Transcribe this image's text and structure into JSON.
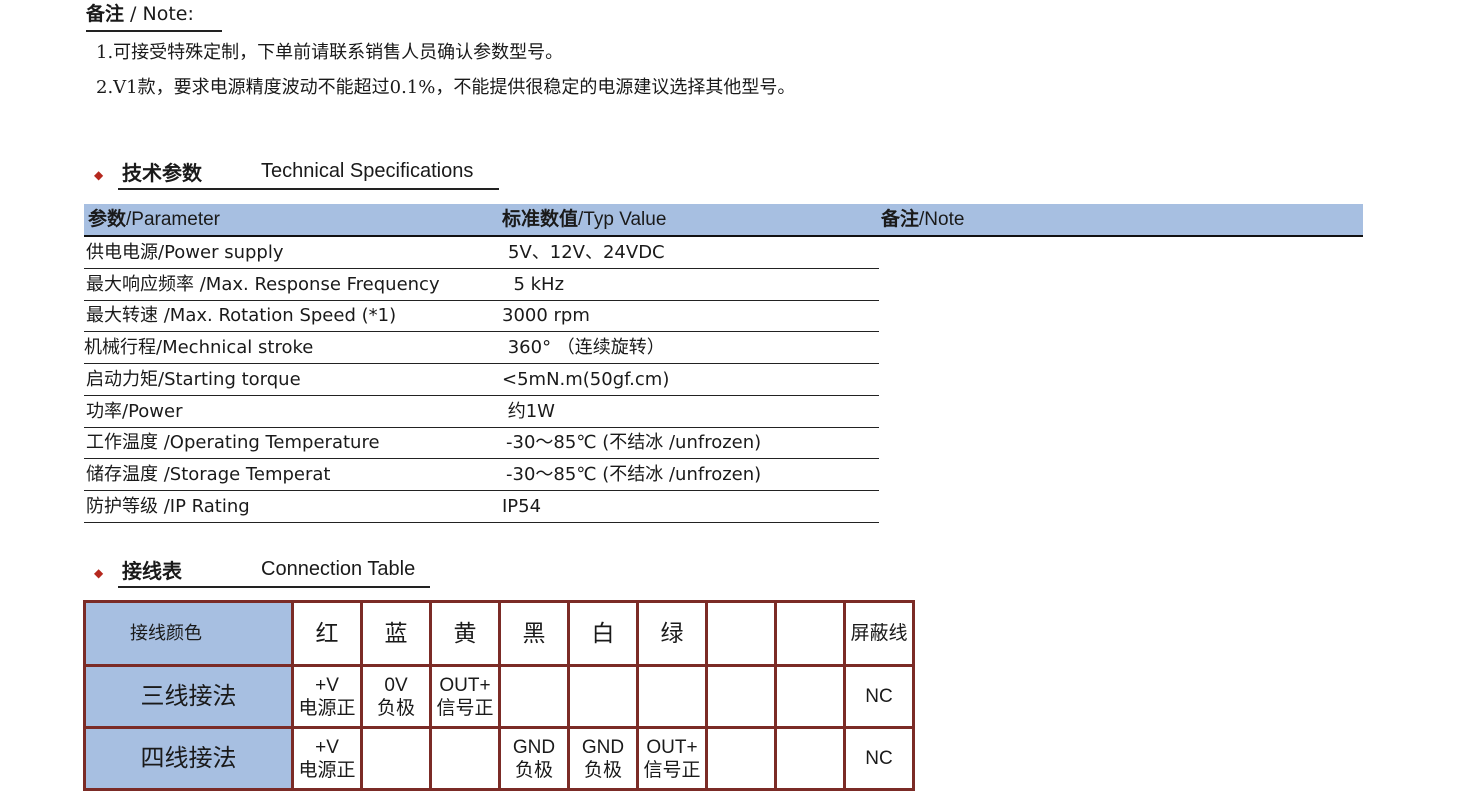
{
  "note": {
    "title_zh": "备注",
    "title_en": " / Note:",
    "items": [
      "1.可接受特殊定制，下单前请联系销售人员确认参数型号。",
      "2.V1款，要求电源精度波动不能超过0.1%，不能提供很稳定的电源建议选择其他型号。"
    ]
  },
  "tech_specs": {
    "heading_zh": "技术参数",
    "heading_en": "Technical Specifications",
    "columns": {
      "param_zh": "参数",
      "param_en": "/Parameter",
      "value_zh": "标准数值",
      "value_en": "/Typ Value",
      "note_zh": "备注",
      "note_en": "/Note"
    },
    "rows": [
      {
        "param": "供电电源/Power supply",
        "value": "5V、12V、24VDC"
      },
      {
        "param": "最大响应频率 /Max. Response Frequency",
        "value": "  5 kHz"
      },
      {
        "param": "最大转速 /Max. Rotation Speed (*1)",
        "value": "3000 rpm"
      },
      {
        "param": "机械行程/Mechnical stroke",
        "value": " 360° （连续旋转）"
      },
      {
        "param": "启动力矩/Starting torque",
        "value": "<5mN.m(50gf.cm)"
      },
      {
        "param": "功率/Power",
        "value": " 约1W"
      },
      {
        "param": "工作温度 /Operating Temperature",
        "value": "-30～85℃ (不结冰 /unfrozen)"
      },
      {
        "param": "储存温度 /Storage Temperat",
        "value": "-30～85℃ (不结冰 /unfrozen)"
      },
      {
        "param": "防护等级 /IP Rating",
        "value": "IP54"
      }
    ]
  },
  "connection": {
    "heading_zh": "接线表",
    "heading_en": "Connection Table",
    "color_label": "接线颜色",
    "colors": [
      "红",
      "蓝",
      "黄",
      "黑",
      "白",
      "绿",
      "",
      "",
      "屏蔽线"
    ],
    "three_wire": {
      "label": "三线接法",
      "cells": [
        {
          "top": "+V",
          "bottom": "电源正"
        },
        {
          "top": "0V",
          "bottom": "负极"
        },
        {
          "top": "OUT+",
          "bottom": "信号正"
        },
        {
          "top": "",
          "bottom": ""
        },
        {
          "top": "",
          "bottom": ""
        },
        {
          "top": "",
          "bottom": ""
        },
        {
          "top": "",
          "bottom": ""
        },
        {
          "top": "",
          "bottom": ""
        },
        {
          "top": "NC",
          "bottom": ""
        }
      ]
    },
    "four_wire": {
      "label": "四线接法",
      "cells": [
        {
          "top": "+V",
          "bottom": "电源正"
        },
        {
          "top": "",
          "bottom": ""
        },
        {
          "top": "",
          "bottom": ""
        },
        {
          "top": "GND",
          "bottom": "负极"
        },
        {
          "top": "GND",
          "bottom": "负极"
        },
        {
          "top": "OUT+",
          "bottom": "信号正"
        },
        {
          "top": "",
          "bottom": ""
        },
        {
          "top": "",
          "bottom": ""
        },
        {
          "top": "NC",
          "bottom": ""
        }
      ]
    }
  }
}
